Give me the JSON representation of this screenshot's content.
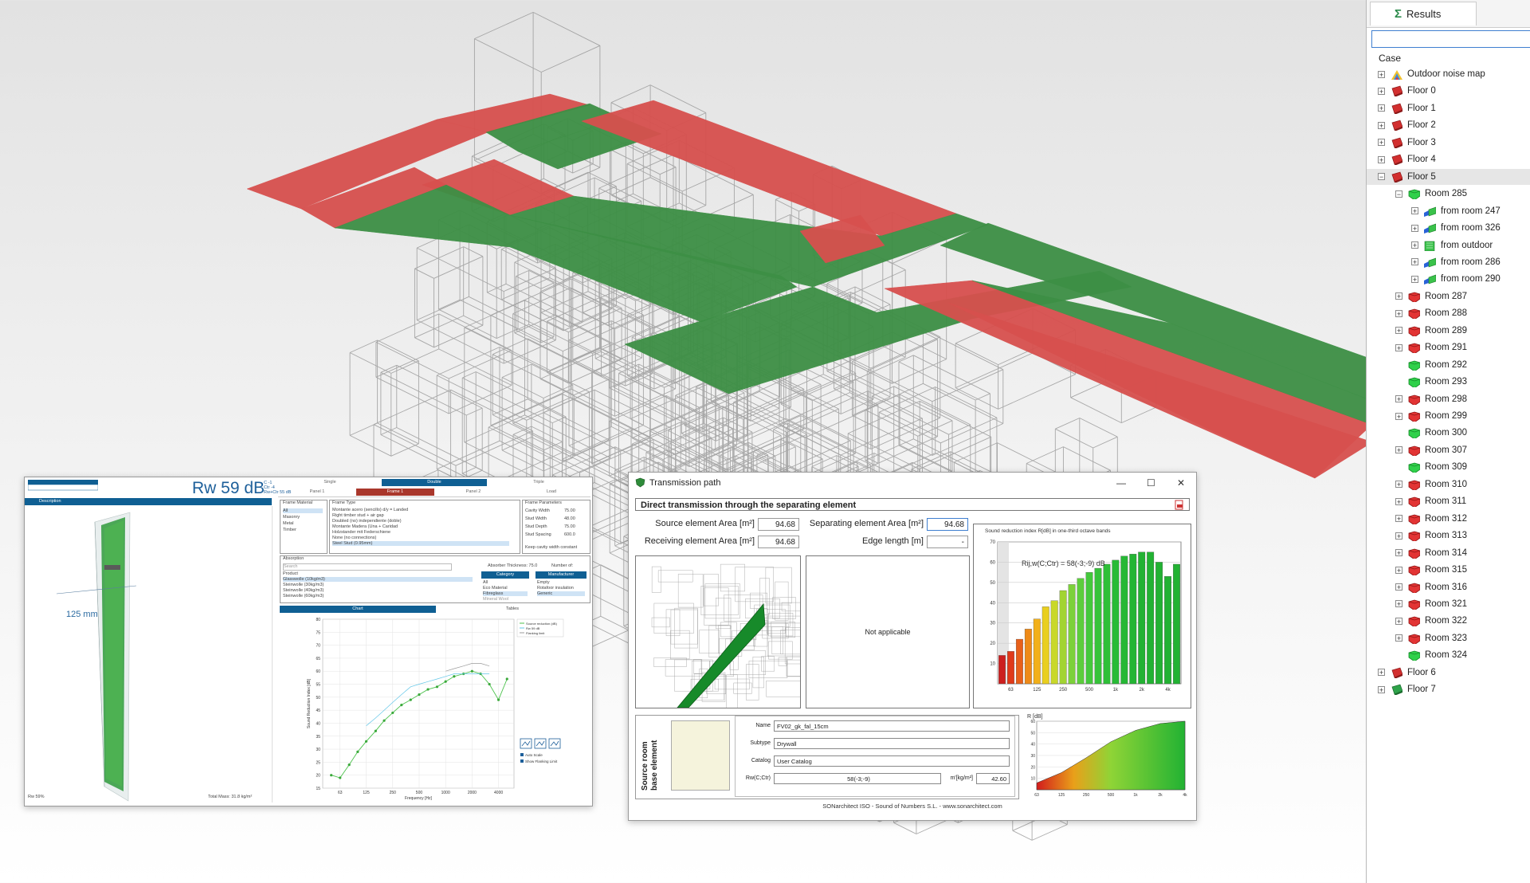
{
  "results": {
    "tab_label": "Results",
    "case_label": "Case",
    "tree": [
      {
        "label": "Outdoor noise map",
        "level": 0,
        "icon": "rainbow",
        "expander": "+"
      },
      {
        "label": "Floor 0",
        "level": 0,
        "icon": "floor-red",
        "expander": "+"
      },
      {
        "label": "Floor 1",
        "level": 0,
        "icon": "floor-red",
        "expander": "+"
      },
      {
        "label": "Floor 2",
        "level": 0,
        "icon": "floor-red",
        "expander": "+"
      },
      {
        "label": "Floor 3",
        "level": 0,
        "icon": "floor-red",
        "expander": "+"
      },
      {
        "label": "Floor 4",
        "level": 0,
        "icon": "floor-red",
        "expander": "+"
      },
      {
        "label": "Floor 5",
        "level": 0,
        "icon": "floor-red",
        "expander": "−",
        "selected": true
      },
      {
        "label": "Room 285",
        "level": 1,
        "icon": "room-green",
        "expander": "−"
      },
      {
        "label": "from room 247",
        "level": 2,
        "icon": "path-blue",
        "expander": "+"
      },
      {
        "label": "from room 326",
        "level": 2,
        "icon": "path-blue",
        "expander": "+"
      },
      {
        "label": "from outdoor",
        "level": 2,
        "icon": "path-outdoor",
        "expander": "+"
      },
      {
        "label": "from room 286",
        "level": 2,
        "icon": "path-blue",
        "expander": "+"
      },
      {
        "label": "from room 290",
        "level": 2,
        "icon": "path-blue",
        "expander": "+"
      },
      {
        "label": "Room 287",
        "level": 1,
        "icon": "room-red",
        "expander": "+"
      },
      {
        "label": "Room 288",
        "level": 1,
        "icon": "room-red",
        "expander": "+"
      },
      {
        "label": "Room 289",
        "level": 1,
        "icon": "room-red",
        "expander": "+"
      },
      {
        "label": "Room 291",
        "level": 1,
        "icon": "room-red",
        "expander": "+"
      },
      {
        "label": "Room 292",
        "level": 1,
        "icon": "room-green",
        "expander": ""
      },
      {
        "label": "Room 293",
        "level": 1,
        "icon": "room-green",
        "expander": ""
      },
      {
        "label": "Room 298",
        "level": 1,
        "icon": "room-red",
        "expander": "+"
      },
      {
        "label": "Room 299",
        "level": 1,
        "icon": "room-red",
        "expander": "+"
      },
      {
        "label": "Room 300",
        "level": 1,
        "icon": "room-green",
        "expander": ""
      },
      {
        "label": "Room 307",
        "level": 1,
        "icon": "room-red",
        "expander": "+"
      },
      {
        "label": "Room 309",
        "level": 1,
        "icon": "room-green",
        "expander": ""
      },
      {
        "label": "Room 310",
        "level": 1,
        "icon": "room-red",
        "expander": "+"
      },
      {
        "label": "Room 311",
        "level": 1,
        "icon": "room-red",
        "expander": "+"
      },
      {
        "label": "Room 312",
        "level": 1,
        "icon": "room-red",
        "expander": "+"
      },
      {
        "label": "Room 313",
        "level": 1,
        "icon": "room-red",
        "expander": "+"
      },
      {
        "label": "Room 314",
        "level": 1,
        "icon": "room-red",
        "expander": "+"
      },
      {
        "label": "Room 315",
        "level": 1,
        "icon": "room-red",
        "expander": "+"
      },
      {
        "label": "Room 316",
        "level": 1,
        "icon": "room-red",
        "expander": "+"
      },
      {
        "label": "Room 321",
        "level": 1,
        "icon": "room-red",
        "expander": "+"
      },
      {
        "label": "Room 322",
        "level": 1,
        "icon": "room-red",
        "expander": "+"
      },
      {
        "label": "Room 323",
        "level": 1,
        "icon": "room-red",
        "expander": "+"
      },
      {
        "label": "Room 324",
        "level": 1,
        "icon": "room-green",
        "expander": ""
      },
      {
        "label": "Floor 6",
        "level": 0,
        "icon": "floor-red",
        "expander": "+"
      },
      {
        "label": "Floor 7",
        "level": 0,
        "icon": "floor-green",
        "expander": "+"
      }
    ]
  },
  "acoustic": {
    "rw_label": "Rw 59 dB",
    "rw_sub": [
      "C -1",
      "Ctr -4",
      "Rw+Ctr 55 dB"
    ],
    "description_label": "Description",
    "dimension_label": "125 mm",
    "mass_label": "Total Mass: 31.8 kg/m²",
    "rw_foot": "Rw 59%",
    "wall_types": [
      "Single",
      "Double",
      "Triple"
    ],
    "frame_tabs": [
      "Panel 1",
      "Frame 1",
      "Panel 2",
      "Load"
    ],
    "frame_material_label": "Frame Material",
    "frame_materials": [
      "All",
      "Masonry",
      "Metal",
      "Timber"
    ],
    "frame_type_label": "Frame Type",
    "frame_types": [
      "Montante acero (sencillo) d/y = Landed",
      "Right timber stud + air gap",
      "Doubled (no) independiente (doble)",
      "Montante Madera (Una + Caridad",
      "Holzstander mit Federschiene",
      "None (no connections)",
      "Steel Stud (0.95mm)"
    ],
    "frame_params_label": "Frame Parameters",
    "frame_params": [
      [
        "Cavity Width",
        "75.00"
      ],
      [
        "Stud Width",
        "48.00"
      ],
      [
        "Stud Depth",
        "75.00"
      ],
      [
        "Stud Spacing",
        "600.0"
      ]
    ],
    "keep_cavity": "Keep cavity width constant",
    "absorption_label": "Absorption",
    "search_label": "Search",
    "absorber_thickness": "Absorber Thickness: 75.0",
    "number_label": "Number of:",
    "product_label": "Product",
    "products": [
      "Glasswolle (10kg/m3)",
      "Steinwolle (30kg/m3)",
      "Steinwolle (40kg/m3)",
      "Steinwolle (60kg/m3)"
    ],
    "category_label": "Category",
    "categories": [
      "All",
      "Eco Material",
      "Fibreglass",
      "Mineral Wool"
    ],
    "manufacturer_label": "Manufacturer",
    "manufacturers": [
      "Empty",
      "Rotafoor insulation",
      "Generic"
    ],
    "chart_tab": "Chart",
    "tables_tab": "Tables",
    "auto_scale": "Auto Scale",
    "show_flanking": "Show Flanking Limit"
  },
  "transmission": {
    "window_title": "Transmission path",
    "section_title": "Direct transmission through the separating element",
    "source_area_label": "Source element Area [m²]",
    "source_area_value": "94.68",
    "receiving_area_label": "Receiving element Area [m²]",
    "receiving_area_value": "94.68",
    "separating_area_label": "Separating element Area [m²]",
    "separating_area_value": "94.68",
    "edge_length_label": "Edge length [m]",
    "edge_length_value": "-",
    "not_applicable": "Not applicable",
    "chart_title": "Sound reduction index R[dB] in one-third octave bands",
    "rating": "Rij,w(C;Ctr) = 58(-3;-9) dB",
    "source_room_label": "Source room",
    "base_element_label": "base element",
    "name_label": "Name",
    "name_value": "FV02_gk_fal_15cm",
    "subtype_label": "Subtype",
    "subtype_value": "Drywall",
    "catalog_label": "Catalog",
    "catalog_value": "User Catalog",
    "rw_label": "Rw(C;Ctr)",
    "rw_value": "58(-3;-9)",
    "mass_label": "m'[kg/m²]",
    "mass_value": "42.60",
    "mini_ylabel": "R [dB]",
    "footer": "SONarchitect ISO - Sound of Numbers S.L. - www.sonarchitect.com"
  },
  "chart_data": [
    {
      "type": "bar",
      "title": "Sound reduction index R[dB] in one-third octave bands",
      "xlabel": "",
      "ylabel": "",
      "categories": [
        "50",
        "63",
        "80",
        "100",
        "125",
        "160",
        "200",
        "250",
        "315",
        "400",
        "500",
        "630",
        "800",
        "1k",
        "1.25k",
        "1.6k",
        "2k",
        "2.5k",
        "3.15k",
        "4k",
        "5k"
      ],
      "x_tick_labels": [
        "63",
        "125",
        "250",
        "500",
        "1k",
        "2k",
        "4k"
      ],
      "values": [
        14,
        16,
        22,
        27,
        32,
        38,
        41,
        46,
        49,
        52,
        55,
        57,
        59,
        61,
        63,
        64,
        65,
        65,
        60,
        53,
        59
      ],
      "ylim": [
        0,
        70
      ],
      "y_ticks": [
        10,
        20,
        30,
        40,
        50,
        60,
        70
      ],
      "annotation": "Rij,w(C;Ctr) = 58(-3;-9) dB",
      "grid": true,
      "colors": [
        "#cc1f1f",
        "#e03a1a",
        "#e8601a",
        "#ee8a18",
        "#f2b01a",
        "#e9cf1f",
        "#c9d82a",
        "#a2d432",
        "#7cd13a",
        "#5ccd3c",
        "#44c83c",
        "#36c33a",
        "#2ebf38",
        "#28bb36",
        "#26b835",
        "#24b534",
        "#22b233",
        "#22b233",
        "#22b233",
        "#22b233",
        "#22b233"
      ]
    },
    {
      "type": "area",
      "title": "",
      "xlabel": "",
      "ylabel": "R [dB]",
      "x": [
        "63",
        "125",
        "250",
        "500",
        "1k",
        "2k",
        "4k"
      ],
      "values": [
        6,
        15,
        28,
        42,
        52,
        58,
        60
      ],
      "ylim": [
        0,
        60
      ],
      "y_ticks": [
        10,
        20,
        30,
        40,
        50,
        60
      ]
    },
    {
      "type": "line",
      "title": "",
      "xlabel": "Frequency [Hz]",
      "ylabel": "Sound Reduction Index [dB]",
      "x": [
        50,
        63,
        80,
        100,
        125,
        160,
        200,
        250,
        315,
        400,
        500,
        630,
        800,
        1000,
        1250,
        1600,
        2000,
        2500,
        3150,
        4000,
        5000
      ],
      "series": [
        {
          "name": "Source reduction (dB)",
          "values": [
            20,
            19,
            24,
            29,
            33,
            37,
            41,
            44,
            47,
            49,
            51,
            53,
            54,
            56,
            58,
            59,
            60,
            59,
            55,
            49,
            57
          ]
        },
        {
          "name": "Rw 59 dB",
          "values": [
            null,
            null,
            null,
            null,
            39,
            42,
            45,
            48,
            51,
            54,
            55,
            56,
            57,
            58,
            59,
            59,
            59,
            59,
            59,
            null,
            null
          ]
        },
        {
          "name": "Flanking limit",
          "values": [
            null,
            null,
            null,
            null,
            null,
            null,
            null,
            null,
            null,
            null,
            null,
            null,
            null,
            60,
            61,
            62,
            63,
            63,
            62,
            null,
            null
          ]
        }
      ],
      "xlim": [
        40,
        6000
      ],
      "ylim": [
        15,
        80
      ],
      "log_x": true,
      "y_ticks": [
        15,
        20,
        25,
        30,
        35,
        40,
        45,
        50,
        55,
        60,
        65,
        70,
        75,
        80
      ],
      "x_ticks": [
        "63",
        "125",
        "250",
        "500",
        "1000",
        "2000",
        "4000"
      ]
    }
  ]
}
